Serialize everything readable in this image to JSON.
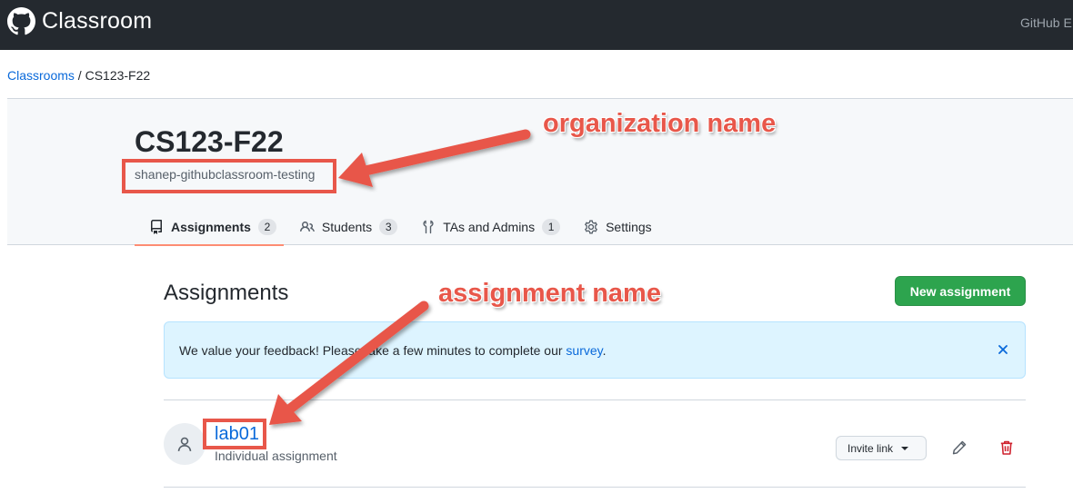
{
  "topbar": {
    "title": "Classroom",
    "right_text": "GitHub E"
  },
  "breadcrumb": {
    "parent": "Classrooms",
    "separator": " / ",
    "current": "CS123-F22"
  },
  "classroom": {
    "title": "CS123-F22",
    "organization": "shanep-githubclassroom-testing"
  },
  "tabs": [
    {
      "label": "Assignments",
      "count": "2",
      "icon": "repo-icon",
      "selected": true
    },
    {
      "label": "Students",
      "count": "3",
      "icon": "people-icon",
      "selected": false
    },
    {
      "label": "TAs and Admins",
      "count": "1",
      "icon": "tools-icon",
      "selected": false
    },
    {
      "label": "Settings",
      "count": null,
      "icon": "gear-icon",
      "selected": false
    }
  ],
  "assignments_section": {
    "title": "Assignments",
    "new_button": "New assignment"
  },
  "flash": {
    "text_before": "We value your feedback! Please take a few minutes to complete our ",
    "link": "survey",
    "text_after": ".",
    "close_icon": "x-icon"
  },
  "assignments": [
    {
      "name": "lab01",
      "type": "Individual assignment",
      "invite_label": "Invite link",
      "edit_icon": "pencil-icon",
      "delete_icon": "trash-icon"
    }
  ],
  "annotations": {
    "org_label": "organization name",
    "assignment_label": "assignment name"
  },
  "colors": {
    "header_bg": "#24292f",
    "link": "#0969da",
    "primary_button": "#2da44e",
    "flash_bg": "#ddf4ff",
    "selected_tab_underline": "#fd8c73",
    "annotation": "#e8574a",
    "danger": "#cf222e"
  }
}
